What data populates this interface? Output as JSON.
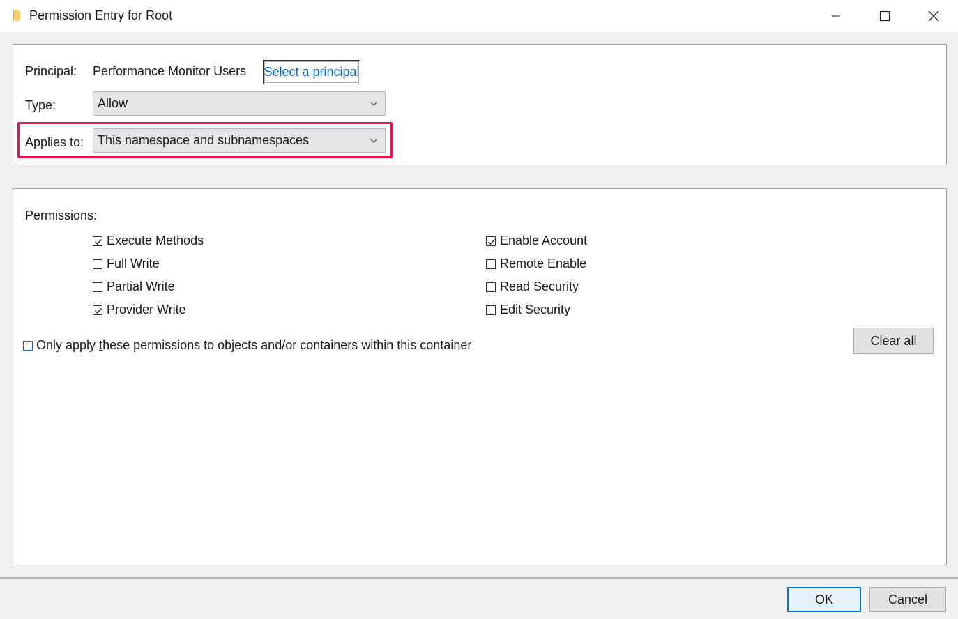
{
  "window": {
    "title": "Permission Entry for Root",
    "icon": "folder-icon"
  },
  "principal": {
    "label": "Principal:",
    "value": "Performance Monitor Users",
    "select_link": "Select a principal"
  },
  "type": {
    "label": "Type:",
    "value": "Allow"
  },
  "applies_to": {
    "label": "Applies to:",
    "value": "This namespace and subnamespaces",
    "highlight_color": "#e8174f"
  },
  "permissions": {
    "label": "Permissions:",
    "left": [
      {
        "label": "Execute Methods",
        "checked": true
      },
      {
        "label": "Full Write",
        "checked": false
      },
      {
        "label": "Partial Write",
        "checked": false
      },
      {
        "label": "Provider Write",
        "checked": true
      }
    ],
    "right": [
      {
        "label": "Enable Account",
        "checked": true
      },
      {
        "label": "Remote Enable",
        "checked": false
      },
      {
        "label": "Read Security",
        "checked": false
      },
      {
        "label": "Edit Security",
        "checked": false
      }
    ]
  },
  "only_apply": {
    "label_pre": "Only apply ",
    "label_underlined": "t",
    "label_post": "hese permissions to objects and/or containers within this container",
    "checked": false
  },
  "buttons": {
    "clear_all": "Clear all",
    "ok": "OK",
    "cancel": "Cancel"
  }
}
